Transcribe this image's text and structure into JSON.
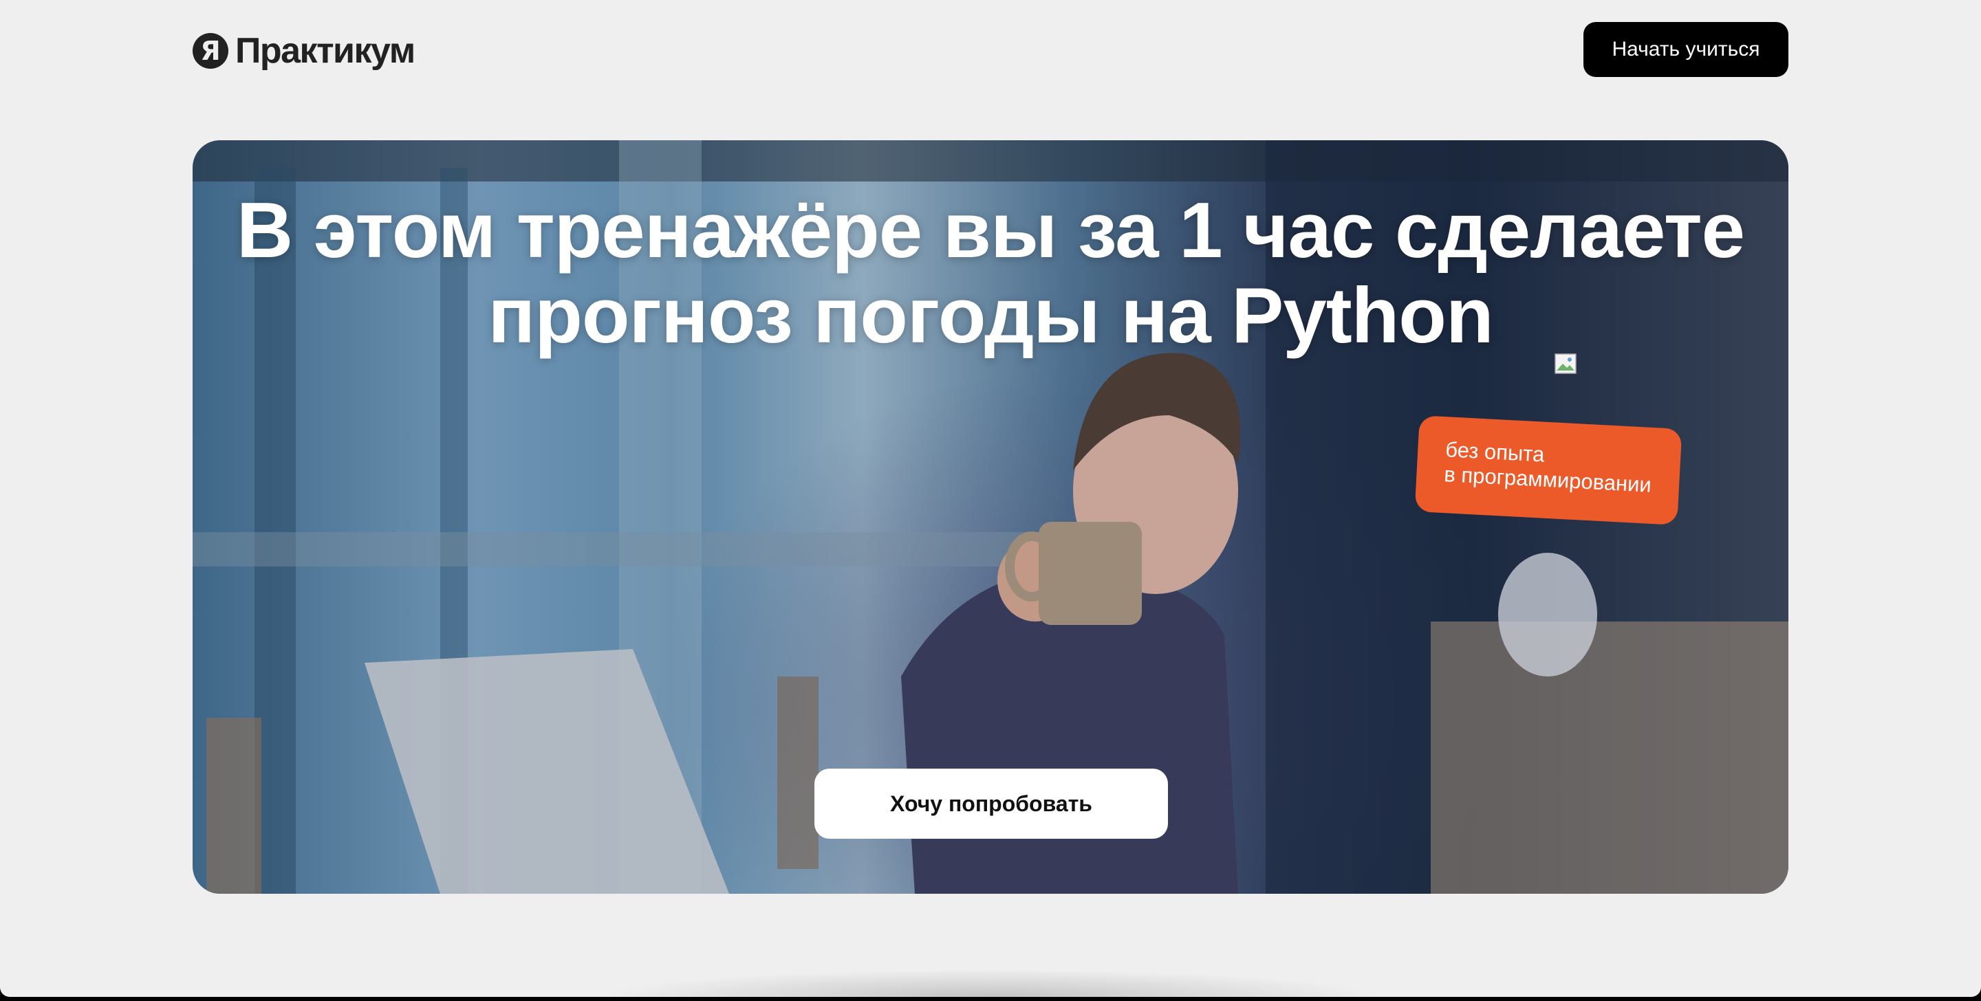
{
  "header": {
    "logo_mark": "Я",
    "logo_text": "Практикум",
    "cta_label": "Начать учиться"
  },
  "hero": {
    "title_line1": "В этом тренажёре вы за 1 час сделаете",
    "title_line2": "прогноз погоды на Python",
    "tag_line1": "без опыта",
    "tag_line2": "в программировании",
    "cta_label": "Хочу попробовать"
  },
  "colors": {
    "page_bg": "#efefef",
    "primary_button": "#000000",
    "tag_bg": "#ec5a2a",
    "hero_button": "#ffffff"
  },
  "icons": {
    "logo": "yandex-ya-icon",
    "broken_image": "broken-image-icon"
  }
}
